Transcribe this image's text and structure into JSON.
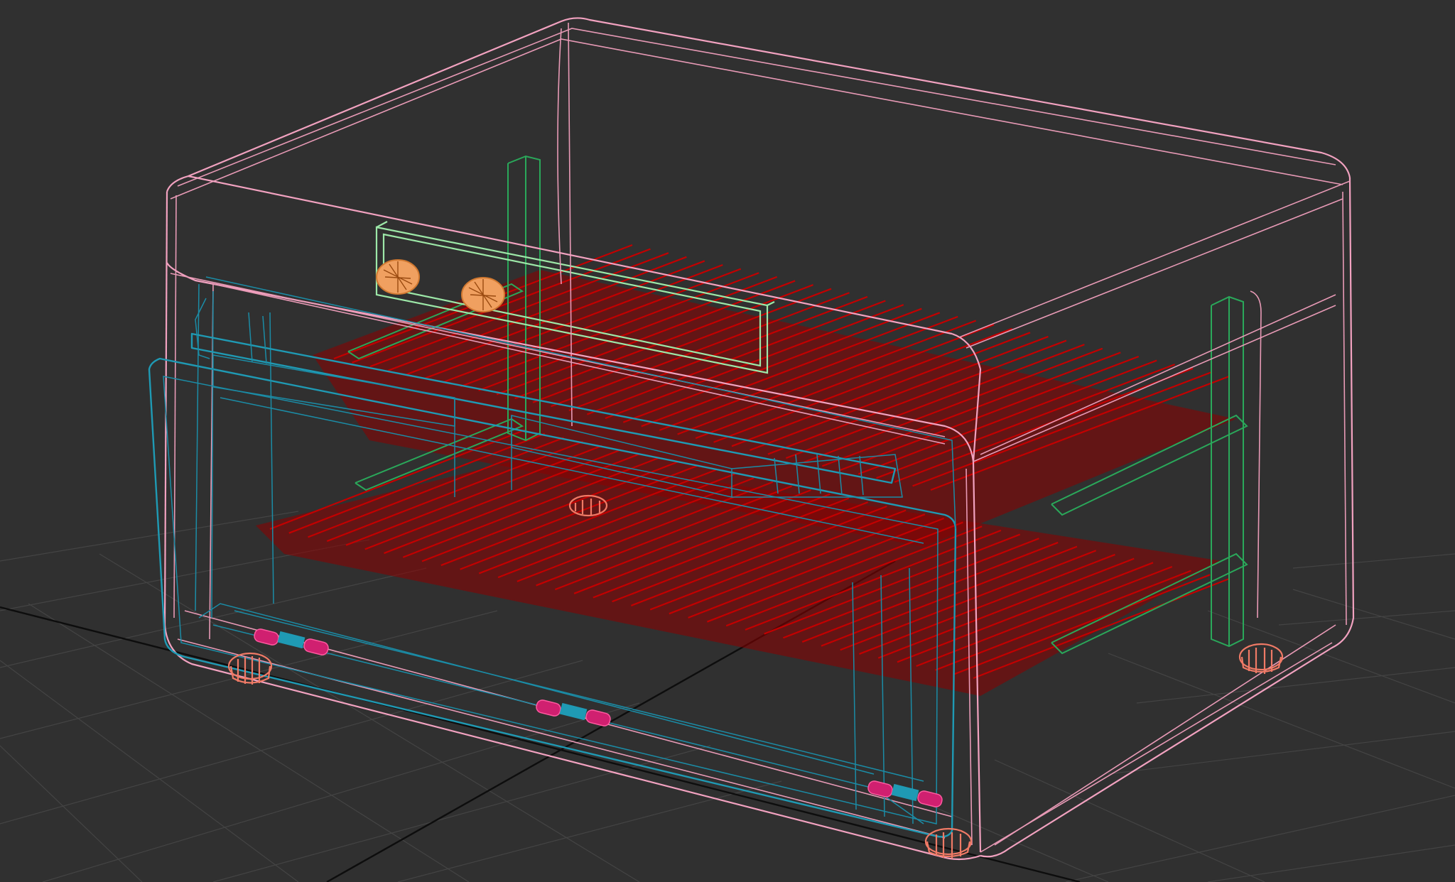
{
  "viewport": {
    "mode": "wireframe",
    "background_color": "#303030",
    "grid_color": "#444444",
    "axis_color": "#0d0d0d"
  },
  "model": {
    "components": [
      {
        "name": "outer-shell",
        "color": "#f2a2c0"
      },
      {
        "name": "front-door-frame",
        "color": "#1f9ab4"
      },
      {
        "name": "rack-upper",
        "color": "#c30000"
      },
      {
        "name": "rack-lower",
        "color": "#c30000"
      },
      {
        "name": "side-supports",
        "color": "#2aa85a"
      },
      {
        "name": "control-panel",
        "color": "#9de8a8"
      },
      {
        "name": "control-knobs",
        "color": "#f0a060"
      },
      {
        "name": "feet",
        "color": "#f07a66"
      },
      {
        "name": "door-hinges",
        "color": "#d02070"
      }
    ]
  }
}
